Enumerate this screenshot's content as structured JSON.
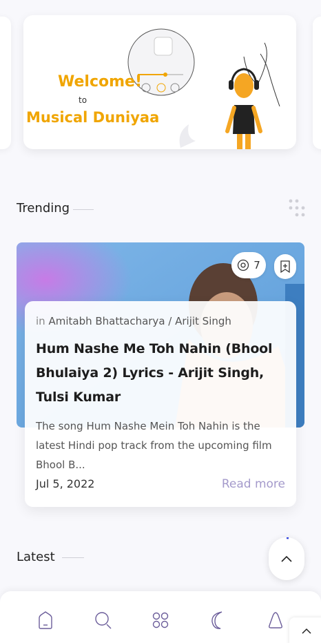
{
  "banner": {
    "welcome": "Welcome!",
    "to": "to",
    "brand": "Musical Duniyaa"
  },
  "trending": {
    "heading": "Trending",
    "views": "7",
    "post": {
      "in_label": "in",
      "categories": "Amitabh Bhattacharya / Arijit Singh",
      "title": "Hum Nashe Me Toh Nahin (Bhool Bhulaiya 2) Lyrics - Arijit Singh, Tulsi Kumar",
      "excerpt": "The song Hum Nashe Mein Toh Nahin is the latest Hindi pop track from the upcoming film Bhool B...",
      "date": "Jul 5, 2022",
      "read_more": "Read more"
    }
  },
  "latest": {
    "heading": "Latest"
  },
  "nav": {
    "items": [
      {
        "icon": "home-icon"
      },
      {
        "icon": "search-icon"
      },
      {
        "icon": "categories-icon"
      },
      {
        "icon": "dark-mode-icon"
      },
      {
        "icon": "notification-icon"
      }
    ]
  },
  "colors": {
    "brand": "#f0a500",
    "accent": "#a49acb",
    "nav_icon": "#6b5d9a"
  }
}
